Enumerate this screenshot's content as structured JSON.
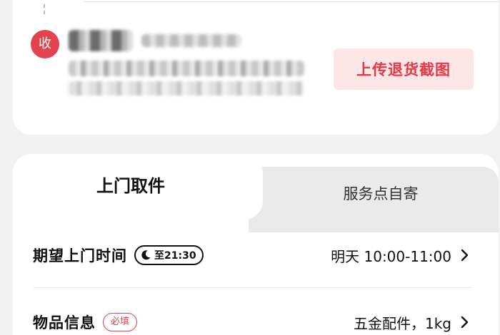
{
  "receiver": {
    "badge": "收"
  },
  "actions": {
    "upload_label": "上传退货截图"
  },
  "tabs": [
    {
      "label": "上门取件",
      "active": true
    },
    {
      "label": "服务点自寄",
      "active": false
    }
  ],
  "pickup_time": {
    "label": "期望上门时间",
    "badge": "至21:30",
    "value": "明天 10:00-11:00"
  },
  "item_info": {
    "label": "物品信息",
    "required_tag": "必填",
    "value": "五金配件，1kg"
  },
  "colors": {
    "accent": "#e5424f",
    "accent_light_bg": "#fde6e7",
    "inactive_tab_bg": "#eaeaea"
  },
  "icons": [
    "moon-icon",
    "chevron-right-icon"
  ]
}
